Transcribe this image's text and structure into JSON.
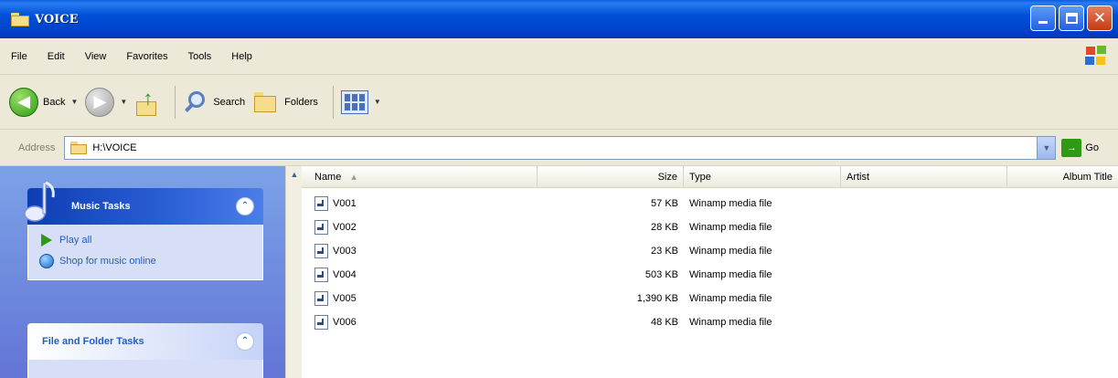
{
  "window": {
    "title": "VOICE"
  },
  "menu": [
    "File",
    "Edit",
    "View",
    "Favorites",
    "Tools",
    "Help"
  ],
  "toolbar": {
    "back_label": "Back",
    "search_label": "Search",
    "folders_label": "Folders"
  },
  "address": {
    "label": "Address",
    "path": "H:\\VOICE",
    "go_label": "Go"
  },
  "tasks": {
    "music_title": "Music Tasks",
    "music_items": [
      "Play all",
      "Shop for music online"
    ],
    "file_title": "File and Folder Tasks"
  },
  "columns": {
    "name": "Name",
    "size": "Size",
    "type": "Type",
    "artist": "Artist",
    "album": "Album Title"
  },
  "files": [
    {
      "name": "V001",
      "size": "57 KB",
      "type": "Winamp media file"
    },
    {
      "name": "V002",
      "size": "28 KB",
      "type": "Winamp media file"
    },
    {
      "name": "V003",
      "size": "23 KB",
      "type": "Winamp media file"
    },
    {
      "name": "V004",
      "size": "503 KB",
      "type": "Winamp media file"
    },
    {
      "name": "V005",
      "size": "1,390 KB",
      "type": "Winamp media file"
    },
    {
      "name": "V006",
      "size": "48 KB",
      "type": "Winamp media file"
    }
  ]
}
